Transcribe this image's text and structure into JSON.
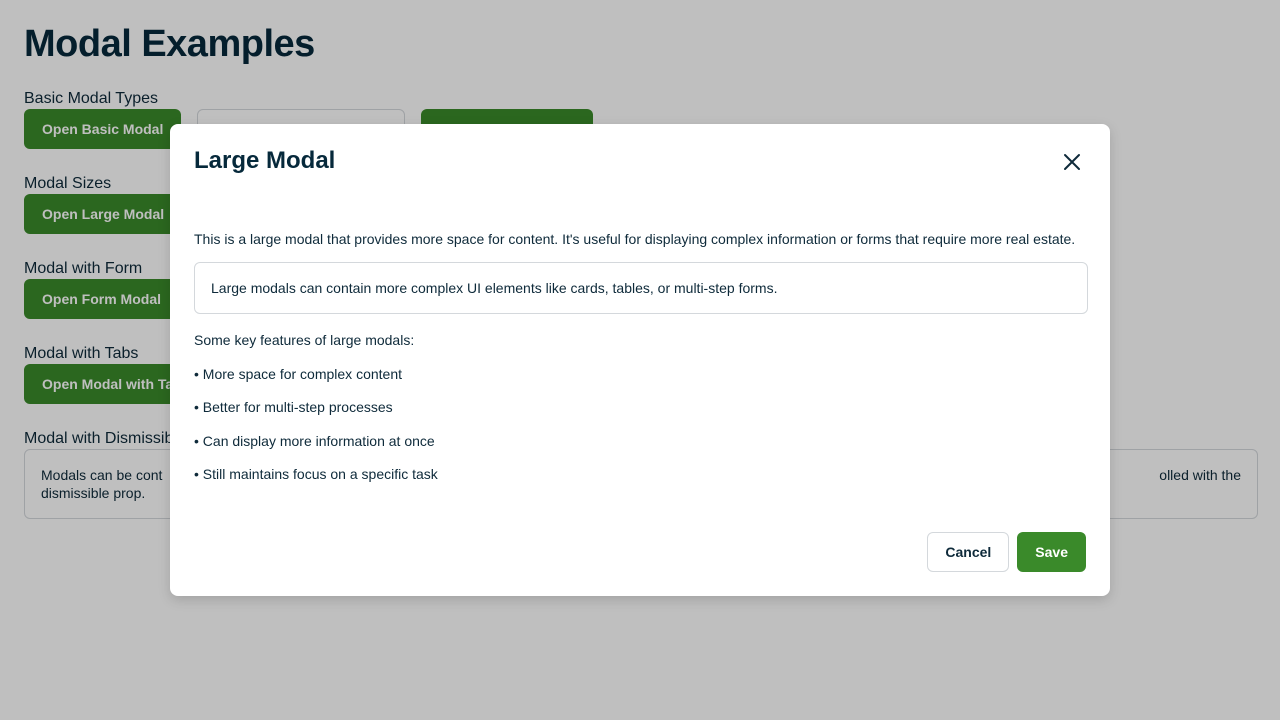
{
  "page": {
    "title": "Modal Examples",
    "sections": [
      {
        "label": "Basic Modal Types",
        "buttons": [
          {
            "label": "Open Basic Modal",
            "style": "primary"
          },
          {
            "label": "",
            "style": "outline"
          },
          {
            "label": "",
            "style": "primary"
          }
        ]
      },
      {
        "label": "Modal Sizes",
        "buttons": [
          {
            "label": "Open Large Modal",
            "style": "primary"
          }
        ]
      },
      {
        "label": "Modal with Form",
        "buttons": [
          {
            "label": "Open Form Modal",
            "style": "primary"
          }
        ]
      },
      {
        "label": "Modal with Tabs",
        "buttons": [
          {
            "label": "Open Modal with Tabs",
            "style": "primary"
          }
        ]
      }
    ],
    "dismiss_section": {
      "label": "Modal with Dismissible Option",
      "text_start": "Modals can be cont",
      "text_end": "olled with the",
      "text_line2": "dismissible prop."
    }
  },
  "modal": {
    "title": "Large Modal",
    "close_icon": "close-icon",
    "description": "This is a large modal that provides more space for content. It's useful for displaying complex information or forms that require more real estate.",
    "callout": "Large modals can contain more complex UI elements like cards, tables, or multi-step forms.",
    "features_intro": "Some key features of large modals:",
    "features": [
      "• More space for complex content",
      "• Better for multi-step processes",
      "• Can display more information at once",
      "• Still maintains focus on a specific task"
    ],
    "cancel_label": "Cancel",
    "save_label": "Save"
  },
  "colors": {
    "primary": "#3a8a2a",
    "text": "#0e2a3a",
    "border": "#d4d8dc",
    "overlay": "rgba(0,0,0,0.25)"
  }
}
